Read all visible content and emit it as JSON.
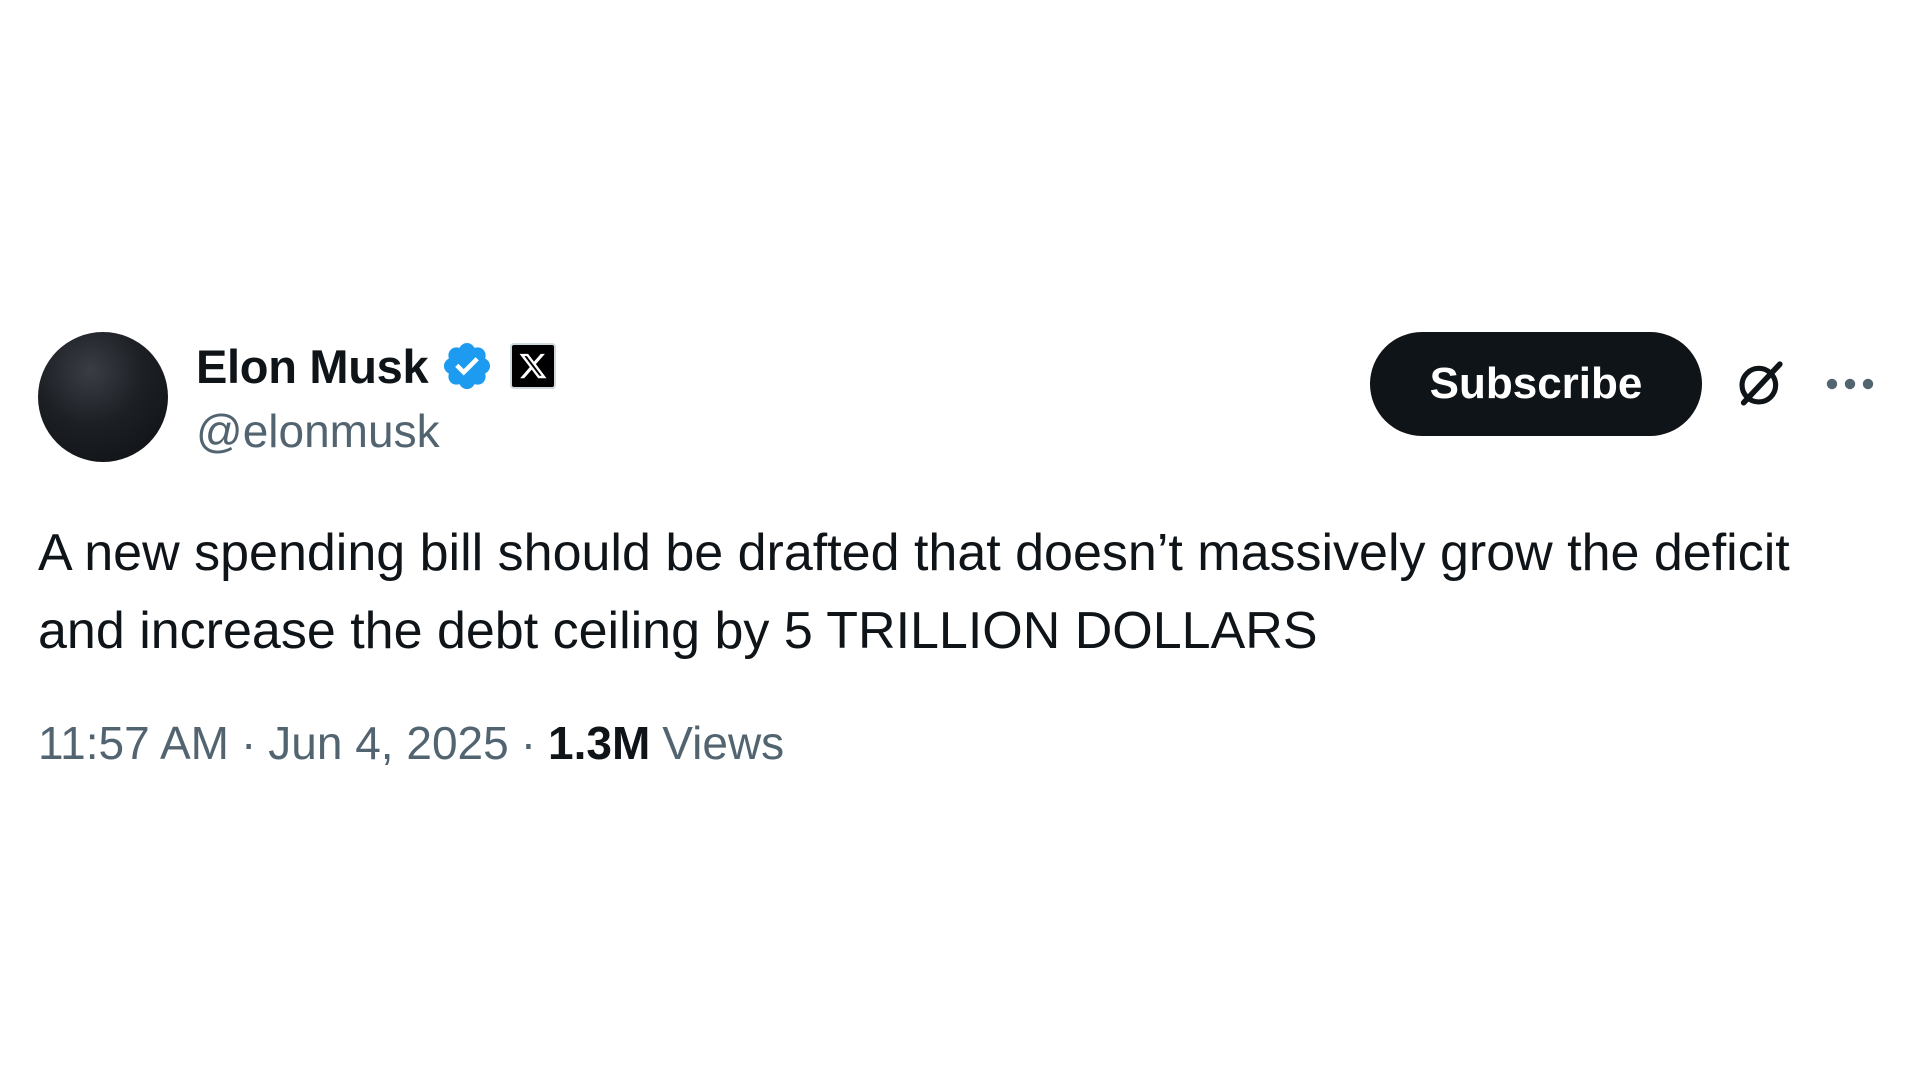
{
  "author": {
    "display_name": "Elon Musk",
    "handle": "@elonmusk",
    "verified_icon": "verified-badge-icon",
    "affiliate_icon": "x-logo-icon"
  },
  "actions": {
    "subscribe_label": "Subscribe",
    "grok_icon": "grok-icon",
    "more_icon": "more-options-icon"
  },
  "tweet": {
    "text": "A new spending bill should be drafted that doesn’t massively grow the deficit and increase the debt ceiling by 5 TRILLION DOLLARS",
    "time": "11:57 AM",
    "separator": "·",
    "date": "Jun 4, 2025",
    "views_count": "1.3M",
    "views_label": "Views"
  },
  "colors": {
    "text_primary": "#0f1419",
    "text_secondary": "#536471",
    "verified_blue": "#1d9bf0",
    "button_bg": "#0f1419"
  }
}
